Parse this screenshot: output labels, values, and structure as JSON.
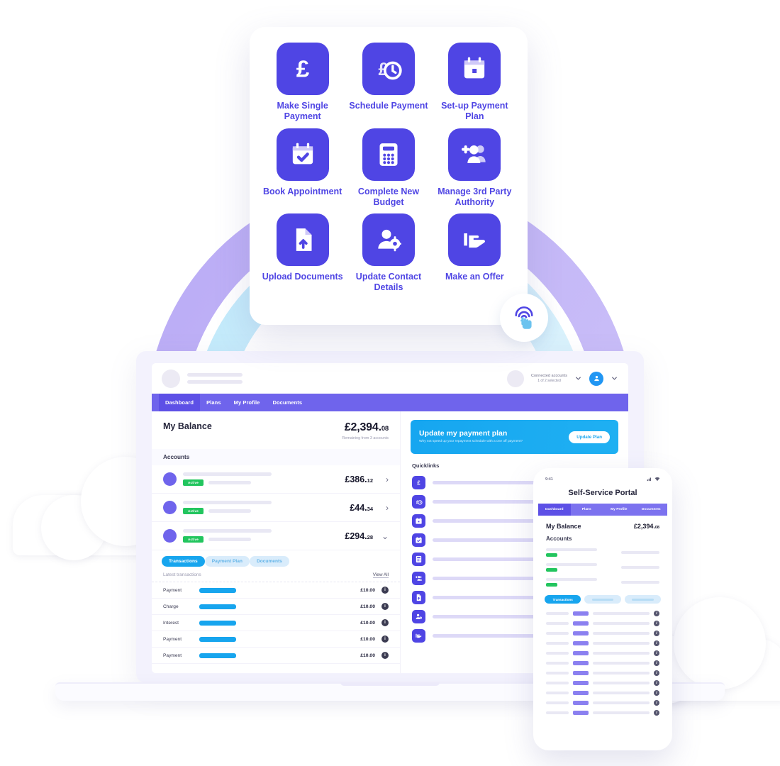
{
  "quick_actions": {
    "items": [
      {
        "label": "Make Single Payment",
        "icon": "pound-icon"
      },
      {
        "label": "Schedule Payment",
        "icon": "pound-clock-icon"
      },
      {
        "label": "Set-up Payment Plan",
        "icon": "calendar-icon"
      },
      {
        "label": "Book Appointment",
        "icon": "calendar-check-icon"
      },
      {
        "label": "Complete New Budget",
        "icon": "calculator-icon"
      },
      {
        "label": "Manage 3rd Party Authority",
        "icon": "add-user-group-icon"
      },
      {
        "label": "Upload Documents",
        "icon": "document-upload-icon"
      },
      {
        "label": "Update Contact Details",
        "icon": "user-gear-icon"
      },
      {
        "label": "Make an Offer",
        "icon": "hand-offer-icon"
      }
    ],
    "tap_icon": "tap-gesture-icon"
  },
  "desktop": {
    "topbar": {
      "account_selector_title": "Connected accounts",
      "account_selector_sub": "1 of 2 selected",
      "chevron_icon": "chevron-down-icon",
      "user_icon": "user-avatar-icon"
    },
    "nav": [
      {
        "label": "Dashboard",
        "active": true
      },
      {
        "label": "Plans",
        "active": false
      },
      {
        "label": "My Profile",
        "active": false
      },
      {
        "label": "Documents",
        "active": false
      }
    ],
    "balance": {
      "label": "My Balance",
      "amount_main": "£2,394.",
      "amount_dec": "08",
      "sub": "Remaining from 3 accounts"
    },
    "accounts_title": "Accounts",
    "accounts": [
      {
        "badge": "Active",
        "amount_main": "£386.",
        "amount_dec": "12",
        "caret": "›"
      },
      {
        "badge": "Active",
        "amount_main": "£44.",
        "amount_dec": "34",
        "caret": "›"
      },
      {
        "badge": "Active",
        "amount_main": "£294.",
        "amount_dec": "28",
        "caret": "⌄"
      }
    ],
    "tabs": [
      {
        "label": "Transactions",
        "active": true
      },
      {
        "label": "Payment Plan",
        "active": false
      },
      {
        "label": "Documents",
        "active": false
      }
    ],
    "latest_label": "Latest transactions",
    "view_all": "View All",
    "transactions": [
      {
        "type": "Payment",
        "amount": "£10.00",
        "info_icon": "info-icon"
      },
      {
        "type": "Charge",
        "amount": "£10.00",
        "info_icon": "info-icon"
      },
      {
        "type": "Interest",
        "amount": "£10.00",
        "info_icon": "info-icon"
      },
      {
        "type": "Payment",
        "amount": "£10.00",
        "info_icon": "info-icon"
      },
      {
        "type": "Payment",
        "amount": "£10.00",
        "info_icon": "info-icon"
      }
    ],
    "banner": {
      "title": "Update my payment plan",
      "sub": "Why not speed up your repayment schedule with a one off payment?",
      "button": "Update Plan"
    },
    "quicklinks_title": "Quicklinks",
    "quicklinks": [
      {
        "icon": "pound-icon"
      },
      {
        "icon": "pound-clock-icon"
      },
      {
        "icon": "calendar-icon"
      },
      {
        "icon": "calendar-check-icon"
      },
      {
        "icon": "calculator-icon"
      },
      {
        "icon": "add-user-group-icon"
      },
      {
        "icon": "document-upload-icon"
      },
      {
        "icon": "user-gear-icon"
      },
      {
        "icon": "hand-offer-icon"
      }
    ]
  },
  "phone": {
    "status_time": "9:41",
    "status_icons": [
      "signal-icon",
      "wifi-icon"
    ],
    "title": "Self-Service Portal",
    "nav": [
      {
        "label": "Dashboard",
        "active": true
      },
      {
        "label": "Plans",
        "active": false
      },
      {
        "label": "My Profile",
        "active": false
      },
      {
        "label": "Documents",
        "active": false
      }
    ],
    "balance_label": "My Balance",
    "balance_main": "£2,394.",
    "balance_dec": "08",
    "accounts_title": "Accounts",
    "account_rows": 3,
    "tabs": [
      {
        "label": "Transactions",
        "active": true
      },
      {
        "label": "",
        "active": false
      },
      {
        "label": "",
        "active": false
      }
    ],
    "transaction_rows": 11
  },
  "colors": {
    "indigo": "#4f45e4",
    "nav_purple": "#6f64ec",
    "cyan": "#17a5ee",
    "green": "#22c55e",
    "arc_purple": "#bfb2f6",
    "arc_cyan": "#c8ecfb"
  }
}
